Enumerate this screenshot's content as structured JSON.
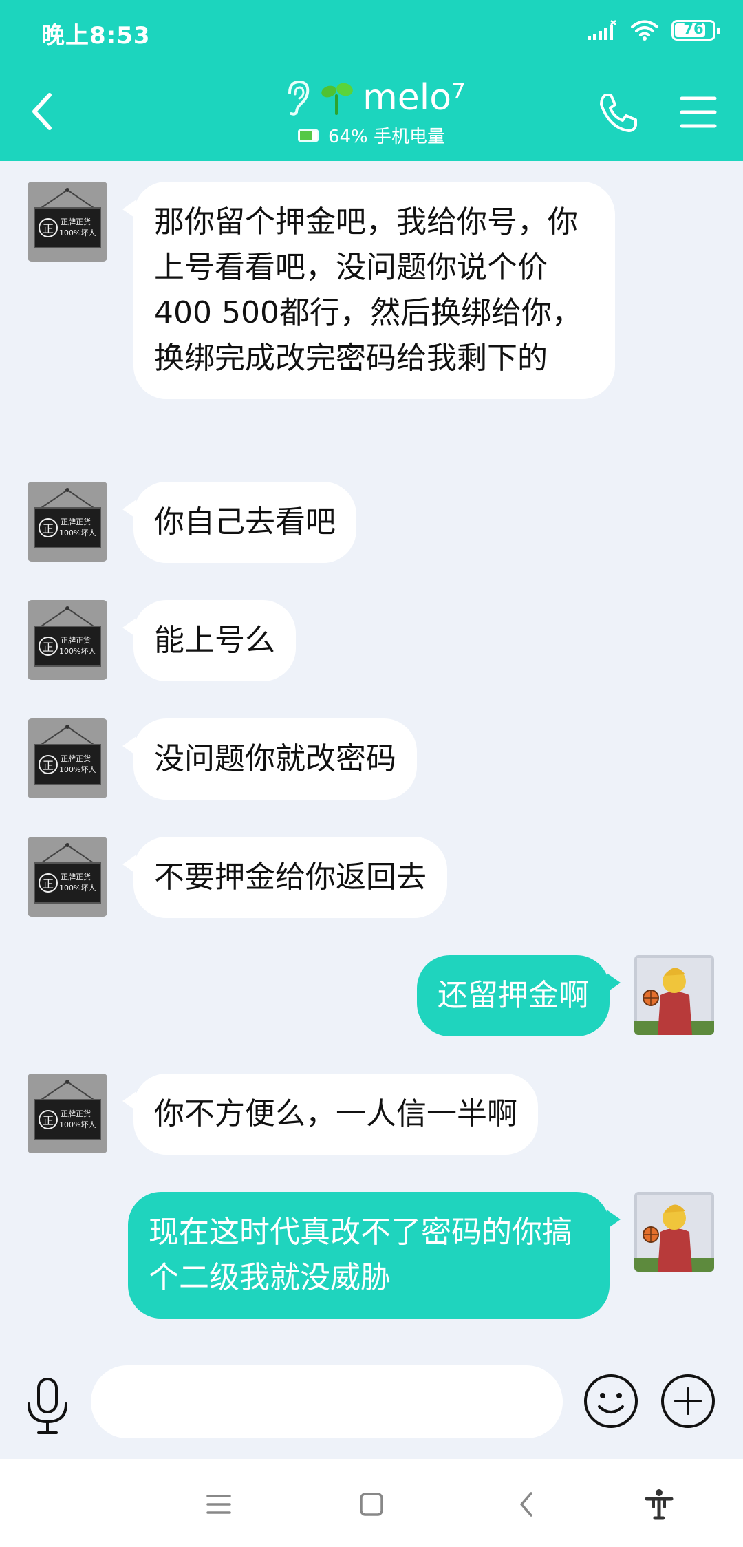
{
  "status_bar": {
    "time": "晚上8:53",
    "battery_level": "76"
  },
  "header": {
    "contact_name": "melo⁷",
    "phone_battery": "64% 手机电量"
  },
  "messages": [
    {
      "side": "left",
      "text": "那你留个押金吧，我给你号，你上号看看吧，没问题你说个价400 500都行，然后换绑给你，换绑完成改完密码给我剩下的"
    },
    {
      "side": "left",
      "text": "你自己去看吧"
    },
    {
      "side": "left",
      "text": "能上号么"
    },
    {
      "side": "left",
      "text": "没问题你就改密码"
    },
    {
      "side": "left",
      "text": "不要押金给你返回去"
    },
    {
      "side": "right",
      "text": "还留押金啊"
    },
    {
      "side": "left",
      "text": "你不方便么，一人信一半啊"
    },
    {
      "side": "right",
      "text": "现在这时代真改不了密码的你搞个二级我就没威胁"
    }
  ],
  "contact_avatar": {
    "line1": "正牌正货",
    "line2": "100%坏人",
    "badge": "正"
  },
  "input": {
    "value": ""
  },
  "colors": {
    "theme": "#1cd5be",
    "chat_bg": "#eef2f9",
    "incoming_bubble": "#ffffff",
    "outgoing_bubble": "#1fd4be"
  },
  "icons": {
    "back": "chevron-left-icon",
    "ear": "ear-icon",
    "sprout": "sprout-icon",
    "call": "phone-icon",
    "menu": "menu-icon",
    "mic": "microphone-icon",
    "emoji": "smiley-icon",
    "plus": "plus-icon",
    "nav_menu": "nav-menu-icon",
    "nav_home": "nav-home-icon",
    "nav_back": "nav-back-icon",
    "nav_accessibility": "accessibility-icon"
  }
}
